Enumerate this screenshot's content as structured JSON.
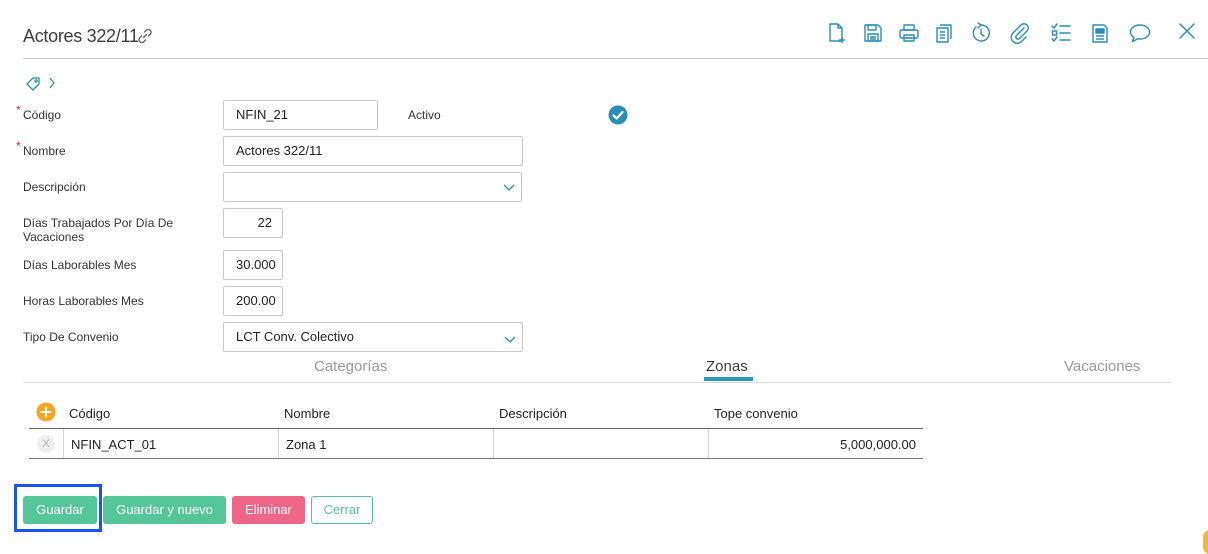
{
  "header": {
    "title": "Actores 322/11",
    "toolbar_icons": [
      "new-document-icon",
      "save-icon",
      "print-icon",
      "copy-icon",
      "history-icon",
      "attachment-icon",
      "checklist-icon",
      "report-icon",
      "comment-icon",
      "close-icon"
    ]
  },
  "form": {
    "codigo_label": "Código",
    "codigo_value": "NFIN_21",
    "activo_label": "Activo",
    "nombre_label": "Nombre",
    "nombre_value": "Actores 322/11",
    "descripcion_label": "Descripción",
    "descripcion_value": "",
    "dias_trabajados_label_1": "Días Trabajados Por Día De",
    "dias_trabajados_label_2": "Vacaciones",
    "dias_trabajados_value": "22",
    "dias_laborables_label": "Días Laborables Mes",
    "dias_laborables_value": "30.000",
    "horas_laborables_label": "Horas Laborables Mes",
    "horas_laborables_value": "200.00",
    "tipo_convenio_label": "Tipo De Convenio",
    "tipo_convenio_value": "LCT Conv. Colectivo",
    "required_mark": "*"
  },
  "tabs": {
    "categorias": "Categorías",
    "zonas": "Zonas",
    "vacaciones": "Vacaciones",
    "active": "Zonas"
  },
  "grid": {
    "headers": {
      "codigo": "Código",
      "nombre": "Nombre",
      "descripcion": "Descripción",
      "tope": "Tope convenio"
    },
    "rows": [
      {
        "delete": "X",
        "codigo": "NFIN_ACT_01",
        "nombre": "Zona 1",
        "descripcion": "",
        "tope": "5,000,000.00"
      }
    ]
  },
  "actions": {
    "guardar": "Guardar",
    "guardar_nuevo": "Guardar y nuevo",
    "eliminar": "Eliminar",
    "cerrar": "Cerrar"
  },
  "colors": {
    "accent_green": "#55c59a",
    "danger_pink": "#f06688",
    "icon_blue": "#2a8db8",
    "focus_blue": "#1a56e8",
    "add_orange": "#f5a623"
  }
}
